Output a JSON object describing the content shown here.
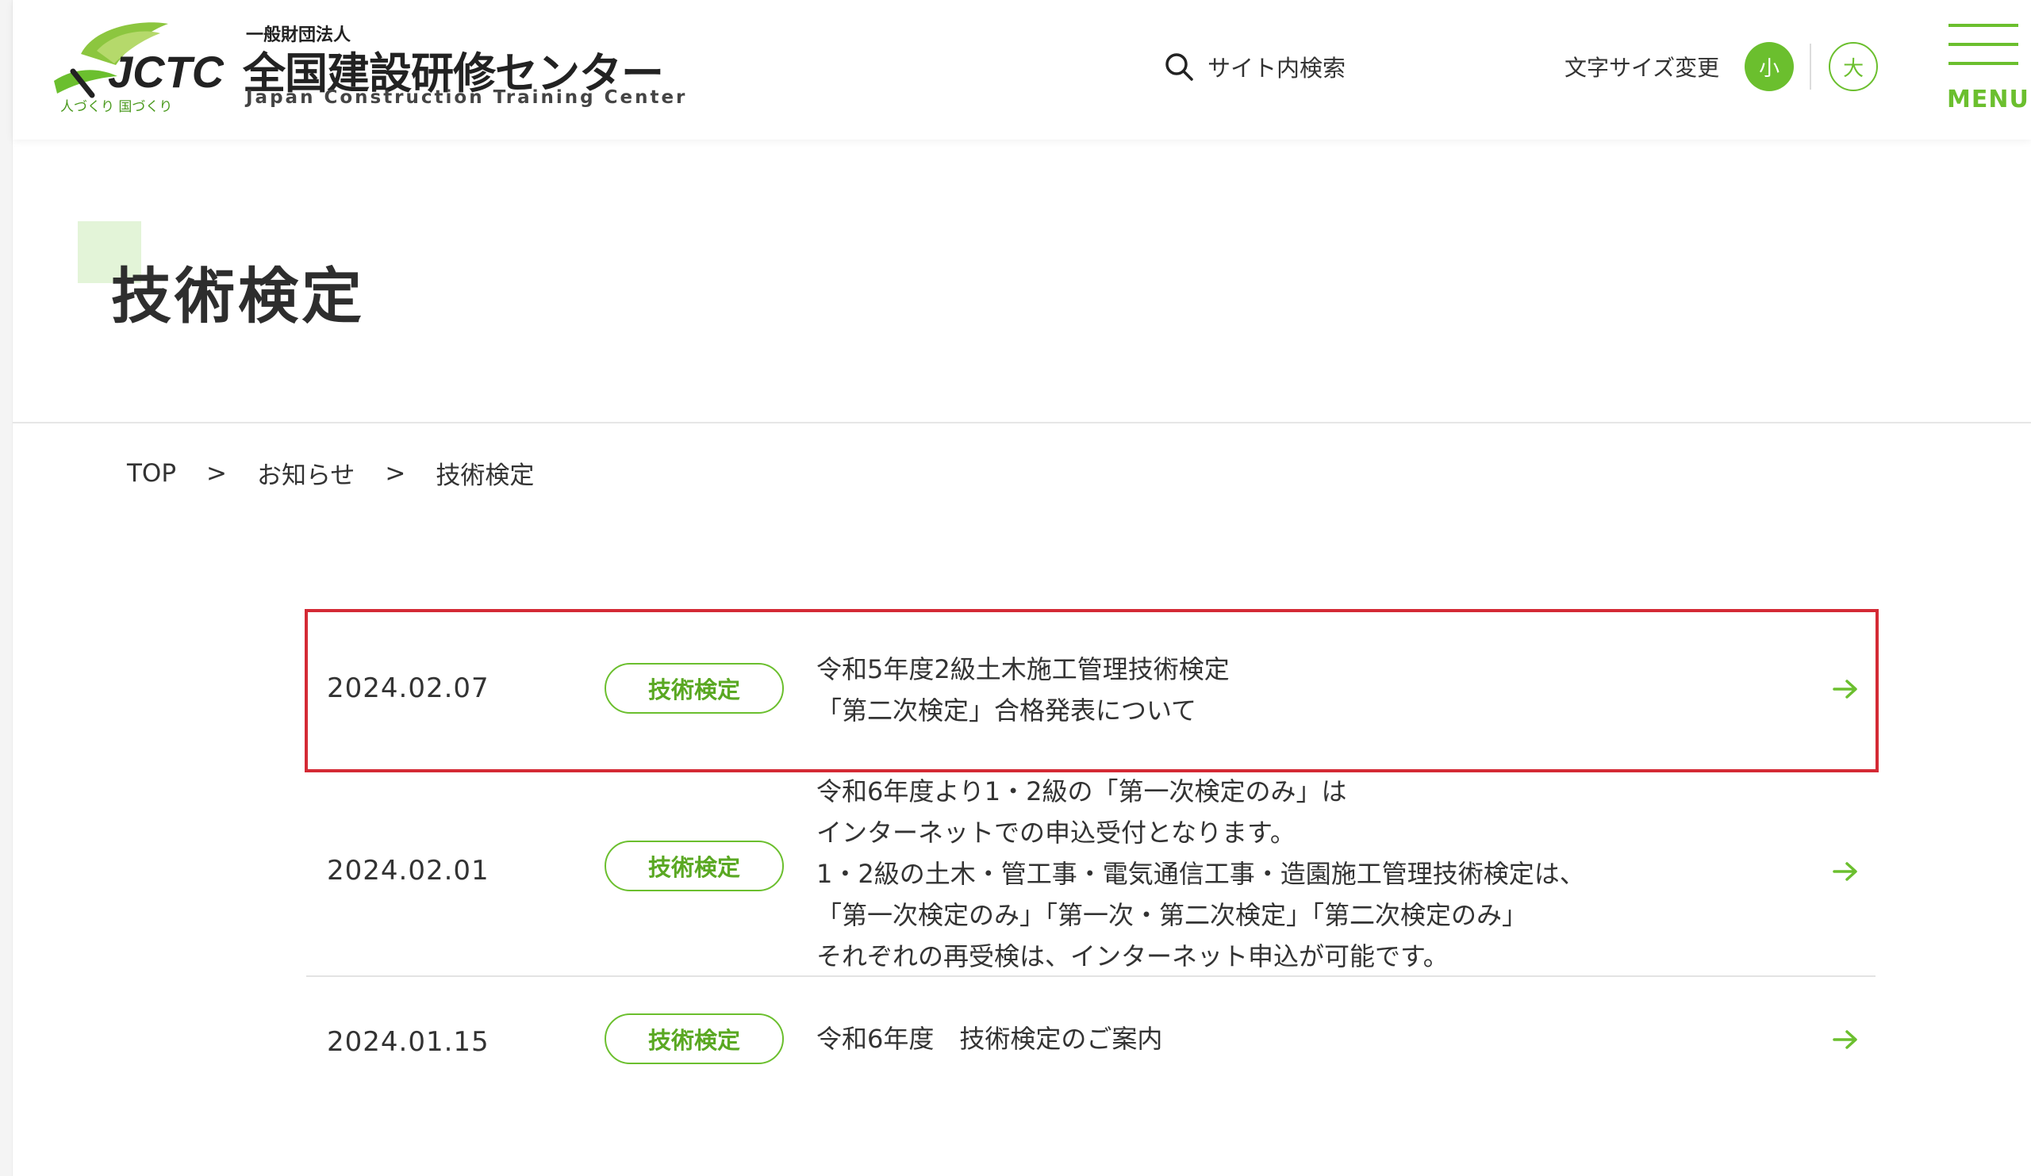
{
  "header": {
    "logo": {
      "mark_text": "JCTC",
      "tagline": "人づくり 国づくり",
      "org_type": "一般財団法人",
      "org_name": "全国建設研修センター",
      "org_name_en": "Japan Construction Training Center"
    },
    "search_label": "サイト内検索",
    "font_size": {
      "label": "文字サイズ変更",
      "small": "小",
      "large": "大"
    },
    "menu_label": "MENU"
  },
  "page_title": "技術検定",
  "breadcrumb": {
    "items": [
      "TOP",
      "お知らせ",
      "技術検定"
    ],
    "separator": ">"
  },
  "news": [
    {
      "date": "2024.02.07",
      "tag": "技術検定",
      "lines": [
        "令和5年度2級土木施工管理技術検定",
        "「第二次検定」合格発表について"
      ]
    },
    {
      "date": "2024.02.01",
      "tag": "技術検定",
      "lines": [
        "令和6年度より1・2級の「第一次検定のみ」は",
        "インターネットでの申込受付となります。",
        "1・2級の土木・管工事・電気通信工事・造園施工管理技術検定は、",
        "「第一次検定のみ」「第一次・第二次検定」「第二次検定のみ」",
        "それぞれの再受検は、インターネット申込が可能です。"
      ]
    },
    {
      "date": "2024.01.15",
      "tag": "技術検定",
      "lines": [
        "令和6年度　技術検定のご案内"
      ]
    }
  ],
  "colors": {
    "accent_green": "#6bbf2e",
    "highlight_red": "#d42a35",
    "title_accent": "#e3f4d8"
  }
}
